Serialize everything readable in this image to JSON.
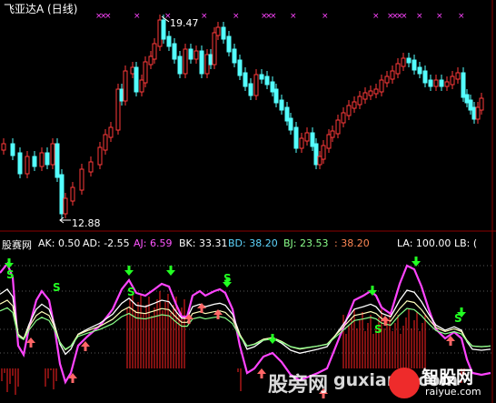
{
  "header": {
    "title": "飞亚达A (日线)"
  },
  "price_chart": {
    "high_label": "19.47",
    "low_label": "12.88",
    "colors": {
      "up": "#ff3a3a",
      "down": "#54ffff",
      "marker": "#ff44ff"
    }
  },
  "indicator": {
    "name": "股赛网",
    "values": [
      {
        "text": "AK: 0.50",
        "color": "#ffffff"
      },
      {
        "text": "AD: -2.55",
        "color": "#ffffff"
      },
      {
        "text": "AJ: 6.59",
        "color": "#ff55ff"
      },
      {
        "text": "BK: 33.31",
        "color": "#ffffff"
      },
      {
        "text": "BD: 38.20",
        "color": "#5fd7ff"
      },
      {
        "text": "BJ: 23.53",
        "color": "#8aff8a"
      },
      {
        "text": ": 38.20",
        "color": "#ff8855"
      }
    ],
    "right_values": [
      {
        "text": "LA: 100.00",
        "color": "#ffffff"
      },
      {
        "text": "LB: (",
        "color": "#ffffff"
      }
    ],
    "signal_letter": "S",
    "colors": {
      "line1": "#ff44ff",
      "line2": "#ffffff",
      "line3": "#ffffbb",
      "line4": "#88ff88",
      "bars": "#ff2222",
      "buy": "#ff6666",
      "sell": "#22ff22"
    }
  },
  "watermark": {
    "left": "股旁网",
    "right": "guxiang.com",
    "logo_text": "智股网",
    "logo_sub": "raiyue.com"
  }
}
